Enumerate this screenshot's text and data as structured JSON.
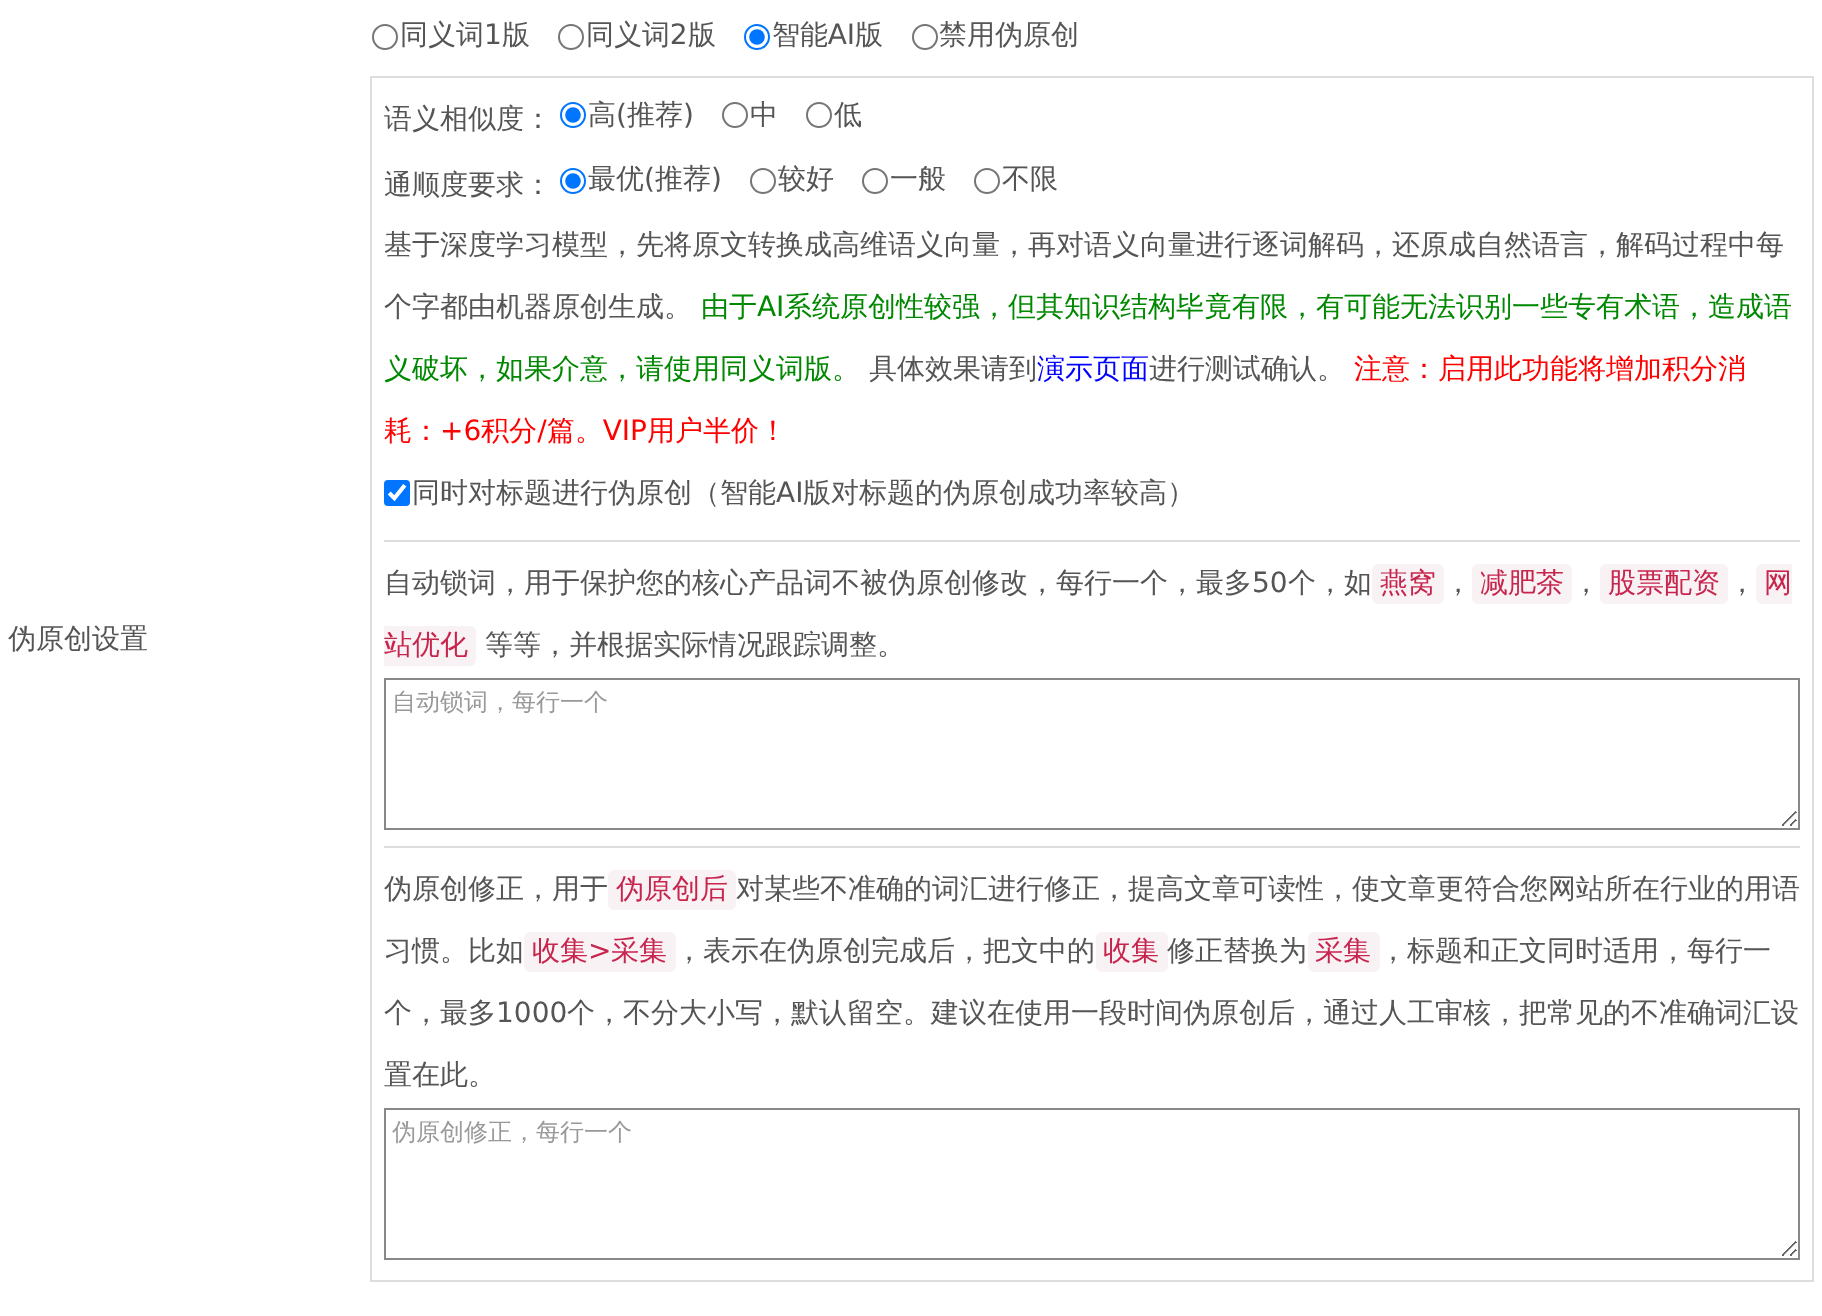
{
  "label": "伪原创设置",
  "modes": [
    {
      "label": "同义词1版",
      "selected": false
    },
    {
      "label": "同义词2版",
      "selected": false
    },
    {
      "label": "智能AI版",
      "selected": true
    },
    {
      "label": "禁用伪原创",
      "selected": false
    }
  ],
  "similarity": {
    "label": "语义相似度：",
    "options": [
      {
        "label": "高(推荐)",
        "selected": true
      },
      {
        "label": "中",
        "selected": false
      },
      {
        "label": "低",
        "selected": false
      }
    ]
  },
  "fluency": {
    "label": "通顺度要求：",
    "options": [
      {
        "label": "最优(推荐)",
        "selected": true
      },
      {
        "label": "较好",
        "selected": false
      },
      {
        "label": "一般",
        "selected": false
      },
      {
        "label": "不限",
        "selected": false
      }
    ]
  },
  "description": [
    {
      "kind": "plain",
      "text": "基于深度学习模型，先将原文转换成高维语义向量，再对语义向量进行逐词解码，还原成自然语言，解码过程中每个字都由机器原创生成。 "
    },
    {
      "kind": "notice",
      "text": "由于AI系统原创性较强，但其知识结构毕竟有限，有可能无法识别一些专有术语，造成语义破坏，如果介意，请使用同义词版。"
    },
    {
      "kind": "plain",
      "text": " 具体效果请到"
    },
    {
      "kind": "link",
      "text": "演示页面"
    },
    {
      "kind": "plain",
      "text": "进行测试确认。 "
    },
    {
      "kind": "warning",
      "text": "注意：启用此功能将增加积分消耗：+6积分/篇。VIP用户半价！"
    }
  ],
  "title_option": {
    "label": "同时对标题进行伪原创（智能AI版对标题的伪原创成功率较高）",
    "checked": true
  },
  "lock_words": {
    "description": [
      {
        "kind": "plain",
        "text": "自动锁词，用于保护您的核心产品词不被伪原创修改，每行一个，最多50个，如"
      },
      {
        "kind": "code",
        "text": "燕窝"
      },
      {
        "kind": "plain",
        "text": "，"
      },
      {
        "kind": "code",
        "text": "减肥茶"
      },
      {
        "kind": "plain",
        "text": "，"
      },
      {
        "kind": "code",
        "text": "股票配资"
      },
      {
        "kind": "plain",
        "text": "，"
      },
      {
        "kind": "code",
        "text": "网站优化"
      },
      {
        "kind": "plain",
        "text": " 等等，并根据实际情况跟踪调整。"
      }
    ],
    "placeholder": "自动锁词，每行一个"
  },
  "corrections": {
    "description": [
      {
        "kind": "plain",
        "text": "伪原创修正，用于"
      },
      {
        "kind": "code",
        "text": "伪原创后"
      },
      {
        "kind": "plain",
        "text": "对某些不准确的词汇进行修正，提高文章可读性，使文章更符合您网站所在行业的用语习惯。比如"
      },
      {
        "kind": "code",
        "text": "收集>采集"
      },
      {
        "kind": "plain",
        "text": "，表示在伪原创完成后，把文中的"
      },
      {
        "kind": "code",
        "text": "收集"
      },
      {
        "kind": "plain",
        "text": "修正替换为"
      },
      {
        "kind": "code",
        "text": "采集"
      },
      {
        "kind": "plain",
        "text": "，标题和正文同时适用，每行一个，最多1000个，不分大小写，默认留空。建议在使用一段时间伪原创后，通过人工审核，把常见的不准确词汇设置在此。"
      }
    ],
    "placeholder": "伪原创修正，每行一个"
  }
}
